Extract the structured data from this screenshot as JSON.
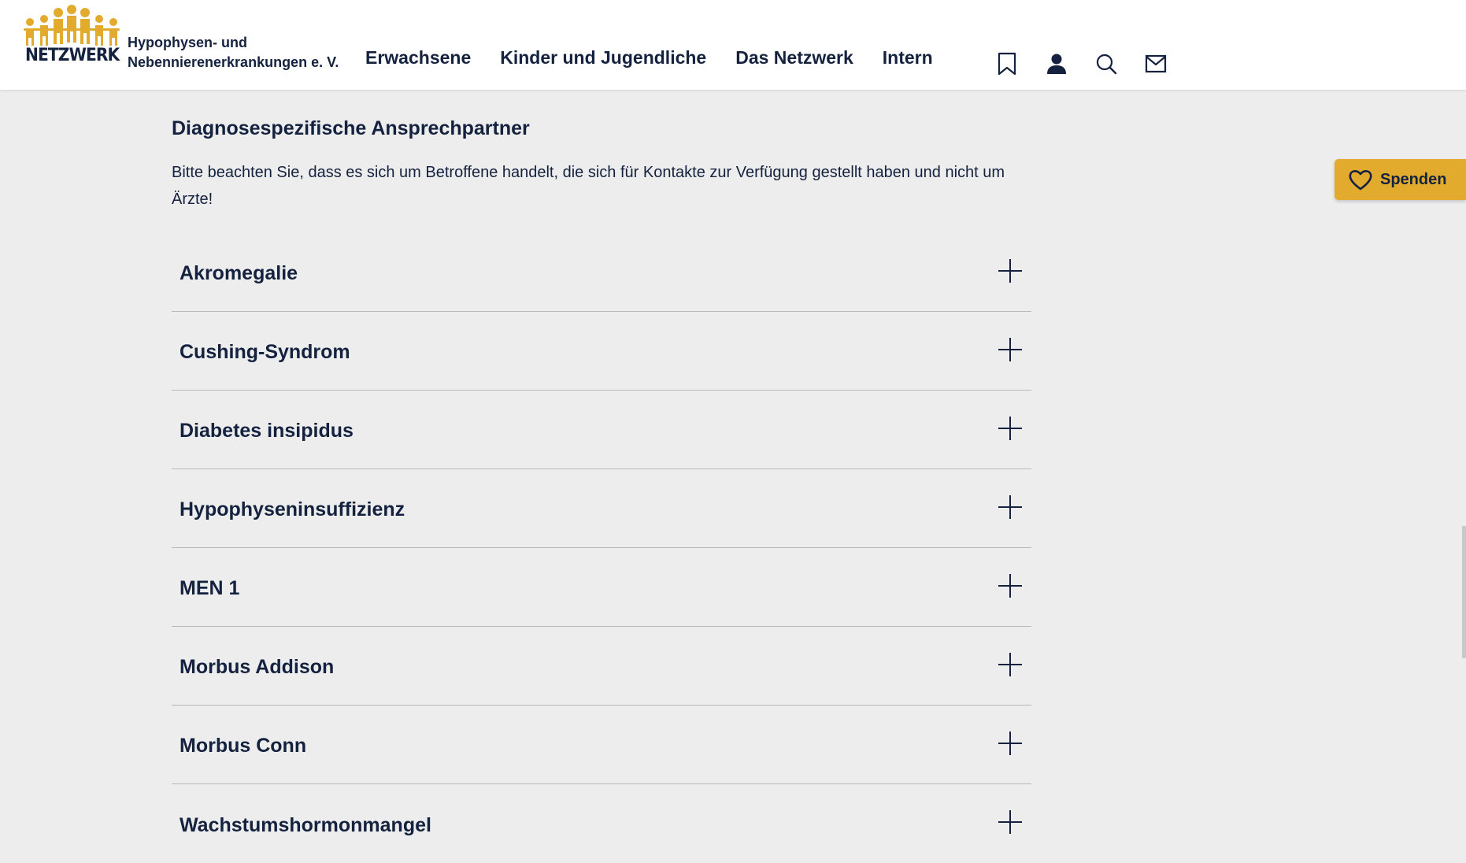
{
  "header": {
    "logo_text": "NETZWERK",
    "org_name_line1": "Hypophysen- und",
    "org_name_line2": "Nebennierenerkrankungen e. V.",
    "nav": [
      {
        "label": "Erwachsene"
      },
      {
        "label": "Kinder und Jugendliche"
      },
      {
        "label": "Das Netzwerk"
      },
      {
        "label": "Intern"
      }
    ],
    "icons": [
      "bookmark-icon",
      "user-icon",
      "search-icon",
      "mail-icon"
    ]
  },
  "donate": {
    "label": "Spenden",
    "icon": "heart-icon"
  },
  "content": {
    "title": "Diagnosespezifische Ansprechpartner",
    "intro": "Bitte beachten Sie, dass es sich um Betroffene handelt, die sich für Kontakte zur Verfügung gestellt haben und nicht um Ärzte!",
    "items": [
      {
        "label": "Akromegalie"
      },
      {
        "label": "Cushing-Syndrom"
      },
      {
        "label": "Diabetes insipidus"
      },
      {
        "label": "Hypophyseninsuffizienz"
      },
      {
        "label": "MEN 1"
      },
      {
        "label": "Morbus Addison"
      },
      {
        "label": "Morbus Conn"
      },
      {
        "label": "Wachstumshormonmangel"
      }
    ]
  },
  "colors": {
    "brand_navy": "#14223f",
    "brand_gold": "#e3ab2e",
    "page_bg": "#ededed"
  }
}
